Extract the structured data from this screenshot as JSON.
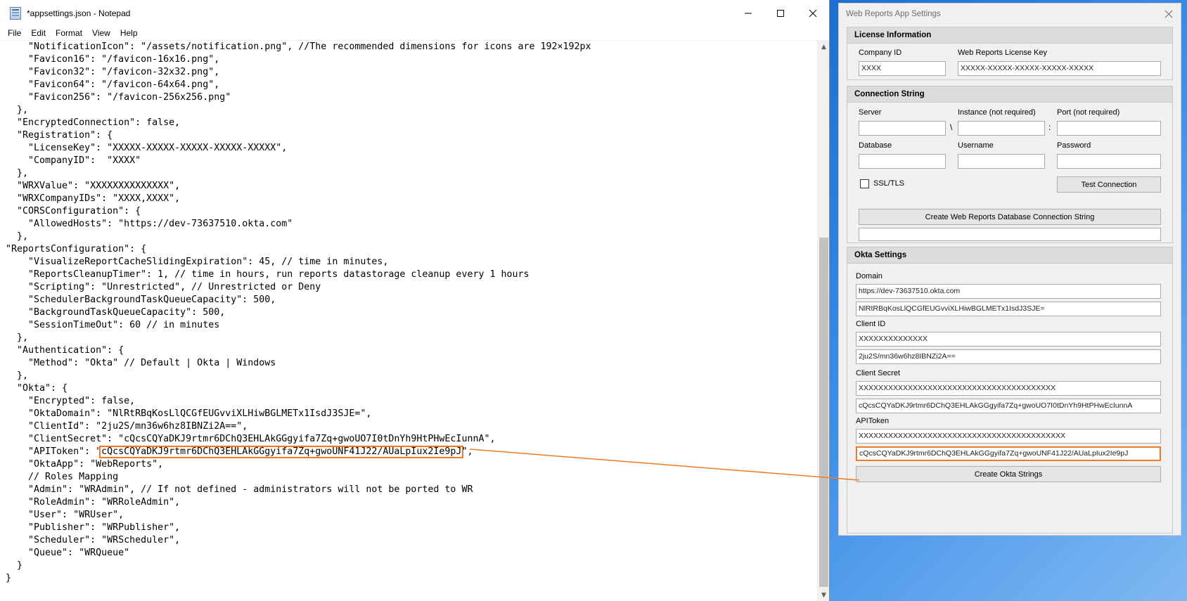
{
  "notepad": {
    "title": "*appsettings.json - Notepad",
    "menu": [
      "File",
      "Edit",
      "Format",
      "View",
      "Help"
    ],
    "lines": [
      "    \"NotificationIcon\": \"/assets/notification.png\", //The recommended dimensions for icons are 192×192px",
      "    \"Favicon16\": \"/favicon-16x16.png\",",
      "    \"Favicon32\": \"/favicon-32x32.png\",",
      "    \"Favicon64\": \"/favicon-64x64.png\",",
      "    \"Favicon256\": \"/favicon-256x256.png\"",
      "  },",
      "  \"EncryptedConnection\": false,",
      "  \"Registration\": {",
      "    \"LicenseKey\": \"XXXXX-XXXXX-XXXXX-XXXXX-XXXXX\",",
      "    \"CompanyID\":  \"XXXX\"",
      "  },",
      "  \"WRXValue\": \"XXXXXXXXXXXXXX\",",
      "  \"WRXCompanyIDs\": \"XXXX,XXXX\",",
      "  \"CORSConfiguration\": {",
      "    \"AllowedHosts\": \"https://dev-73637510.okta.com\"",
      "  },",
      "\"ReportsConfiguration\": {",
      "    \"VisualizeReportCacheSlidingExpiration\": 45, // time in minutes,",
      "    \"ReportsCleanupTimer\": 1, // time in hours, run reports datastorage cleanup every 1 hours",
      "    \"Scripting\": \"Unrestricted\", // Unrestricted or Deny",
      "    \"SchedulerBackgroundTaskQueueCapacity\": 500,",
      "    \"BackgroundTaskQueueCapacity\": 500,",
      "    \"SessionTimeOut\": 60 // in minutes",
      "  },",
      "  \"Authentication\": {",
      "    \"Method\": \"Okta\" // Default | Okta | Windows",
      "  },",
      "  \"Okta\": {",
      "    \"Encrypted\": false,",
      "    \"OktaDomain\": \"NlRtRBqKosLlQCGfEUGvviXLHiwBGLMETx1IsdJ3SJE=\",",
      "    \"ClientId\": \"2ju2S/mn36w6hz8IBNZi2A==\",",
      "    \"ClientSecret\": \"cQcsCQYaDKJ9rtmr6DChQ3EHLAkGGgyifa7Zq+gwoUO7I0tDnYh9HtPHwEcIunnA\",",
      "__TOKEN__",
      "    \"OktaApp\": \"WebReports\",",
      "    // Roles Mapping",
      "    \"Admin\": \"WRAdmin\", // If not defined - administrators will not be ported to WR",
      "    \"RoleAdmin\": \"WRRoleAdmin\",",
      "    \"User\": \"WRUser\",",
      "    \"Publisher\": \"WRPublisher\",",
      "    \"Scheduler\": \"WRScheduler\",",
      "    \"Queue\": \"WRQueue\"",
      "  }",
      "}"
    ],
    "token_line": {
      "prefix": "    \"APIToken\": \"",
      "value": "cQcsCQYaDKJ9rtmr6DChQ3EHLAkGGgyifa7Zq+gwoUNF41J22/AUaLpIux2Ie9pJ",
      "suffix": "\","
    }
  },
  "settings": {
    "title": "Web Reports App Settings",
    "license": {
      "header": "License Information",
      "company_id_label": "Company ID",
      "company_id": "XXXX",
      "license_key_label": "Web Reports License Key",
      "license_key": "XXXXX-XXXXX-XXXXX-XXXXX-XXXXX"
    },
    "connection": {
      "header": "Connection String",
      "server_label": "Server",
      "instance_label": "Instance (not required)",
      "port_label": "Port (not required)",
      "instance_sep": "\\",
      "port_sep": ":",
      "database_label": "Database",
      "username_label": "Username",
      "password_label": "Password",
      "ssl_label": "SSL/TLS",
      "test_button": "Test Connection",
      "create_button": "Create Web Reports Database Connection String",
      "output": ""
    },
    "okta": {
      "header": "Okta Settings",
      "domain_label": "Domain",
      "domain": "https://dev-73637510.okta.com",
      "domain_encrypted": "NlRtRBqKosLlQCGfEUGvviXLHiwBGLMETx1IsdJ3SJE=",
      "client_id_label": "Client ID",
      "client_id": "XXXXXXXXXXXXXX",
      "client_id_encrypted": "2ju2S/mn36w6hz8IBNZi2A==",
      "client_secret_label": "Client Secret",
      "client_secret": "XXXXXXXXXXXXXXXXXXXXXXXXXXXXXXXXXXXXXXXX",
      "client_secret_encrypted": "cQcsCQYaDKJ9rtmr6DChQ3EHLAkGGgyifa7Zq+gwoUO7I0tDnYh9HtPHwEcIunnA",
      "api_token_label": "APIToken",
      "api_token": "XXXXXXXXXXXXXXXXXXXXXXXXXXXXXXXXXXXXXXXXXX",
      "api_token_encrypted": "cQcsCQYaDKJ9rtmr6DChQ3EHLAkGGgyifa7Zq+gwoUNF41J22/AUaLpIux2Ie9pJ",
      "create_button": "Create Okta Strings"
    }
  },
  "colors": {
    "highlight": "#f07a24",
    "desktop": "#1565c8"
  }
}
